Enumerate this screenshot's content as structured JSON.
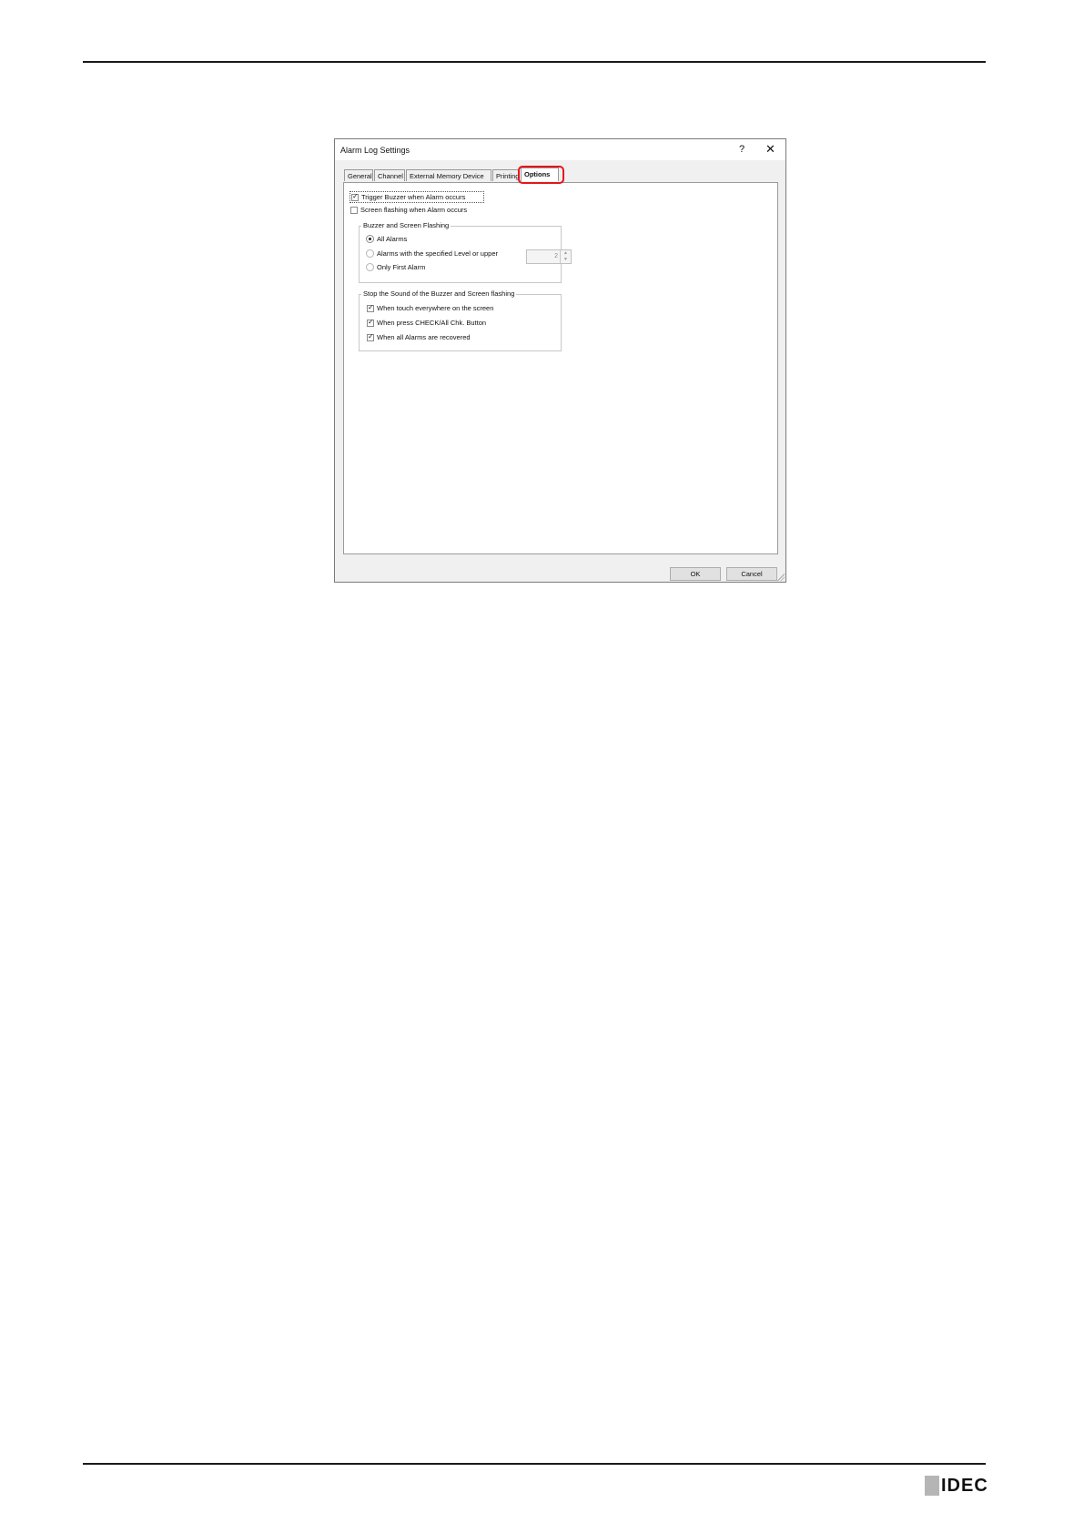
{
  "dialog": {
    "title": "Alarm Log Settings",
    "help_label": "?",
    "close_label": "✕",
    "tabs": [
      {
        "label": "General",
        "active": false
      },
      {
        "label": "Channel",
        "active": false
      },
      {
        "label": "External Memory Device",
        "active": false
      },
      {
        "label": "Printing",
        "active": false
      },
      {
        "label": "Options",
        "active": true
      }
    ],
    "options": {
      "trigger_buzzer": {
        "label": "Trigger Buzzer when Alarm occurs",
        "checked": true
      },
      "screen_flashing": {
        "label": "Screen flashing when Alarm occurs",
        "checked": false
      },
      "buzzer_group": {
        "legend": "Buzzer and Screen Flashing",
        "all_alarms": "All Alarms",
        "level_alarms": "Alarms with the specified Level or upper",
        "first_alarm": "Only First Alarm",
        "level_value": "2",
        "selected": "All Alarms"
      },
      "stop_group": {
        "legend": "Stop the Sound of the Buzzer and Screen flashing",
        "touch": "When touch everywhere on the screen",
        "press_check": "When press CHECK/All Chk. Button",
        "recovered": "When all Alarms are recovered",
        "touch_checked": true,
        "press_checked": true,
        "recovered_checked": true
      }
    },
    "buttons": {
      "ok": "OK",
      "cancel": "Cancel"
    }
  },
  "footer": {
    "logo": "IDEC"
  },
  "colors": {
    "highlight": "#e4161b",
    "dialog_bg": "#f0f0f0"
  }
}
